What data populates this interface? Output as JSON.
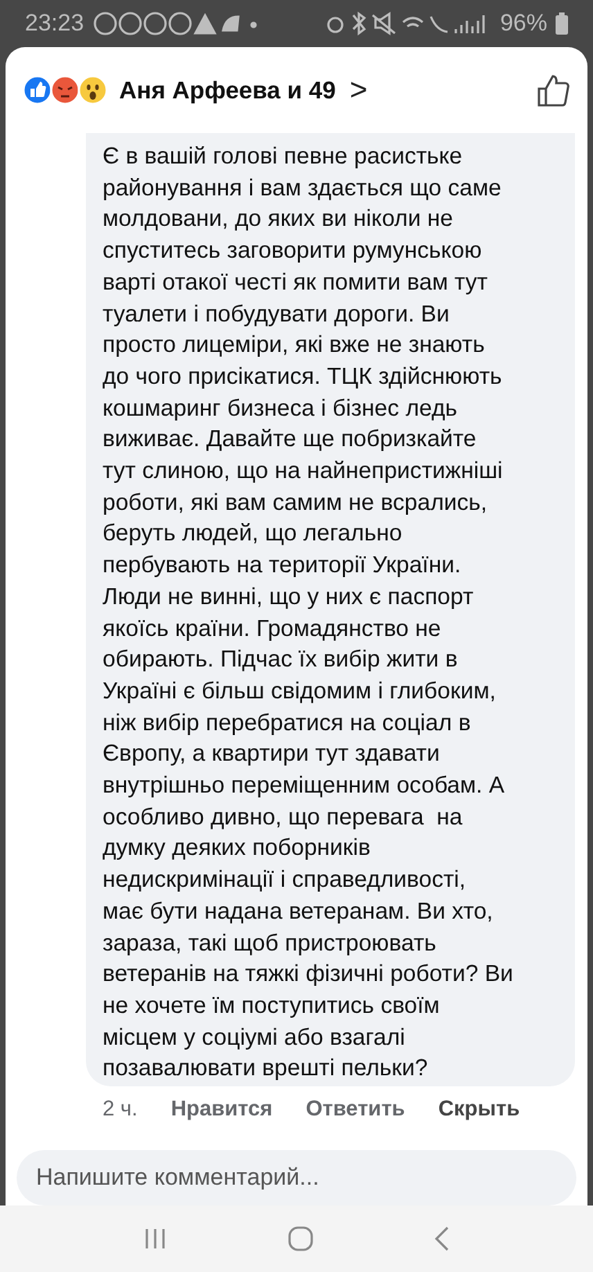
{
  "status_bar": {
    "time": "23:23",
    "battery": "96%"
  },
  "header": {
    "reactors": "Аня Арфеева и 49",
    "chevron": ">"
  },
  "comment": {
    "text": "Є в вашій голові певне расистьке\nрайонування і вам здається що саме\nмолдовани, до яких ви ніколи не\nспуститесь заговорити румунською\nварті отакої честі як помити вам тут\nтуалети і побудувати дороги. Ви\nпросто лицеміри, які вже не знають\nдо чого присікатися. ТЦК здійснюють\nкошмаринг бизнеса і бізнес ледь\nвиживає. Давайте ще побризкайте\nтут слиною, що на найнепристижніші\nроботи, які вам самим не всрались,\nберуть людей, що легально\nпербувають на території України.\nЛюди не винні, що у них є паспорт\nякоїсь країни. Громадянство не\nобирають. Підчас їх вибір жити в\nУкраїні є більш свідомим і глибоким,\nніж вибір перебратися на соціал в\nЄвропу, а квартири тут здавати\nвнутрішньо переміщенним особам. А\nособливо дивно, що перевага  на\nдумку деяких поборників\nнедискримінації і справедливості,\nмає бути надана ветеранам. Ви хто,\nзараза, такі щоб пристроювать\nветеранів на тяжкі фізичні роботи? Ви\nне хочете їм поступитись своїм\nмісцем у соціумі або взагалі\nпозавалювати врешті пельки?",
    "time": "2 ч.",
    "actions": [
      {
        "label": "Нравится",
        "kind": "like"
      },
      {
        "label": "Ответить",
        "kind": "reply"
      },
      {
        "label": "Скрыть",
        "kind": "hide"
      }
    ]
  },
  "composer": {
    "placeholder": "Напишите комментарий..."
  }
}
